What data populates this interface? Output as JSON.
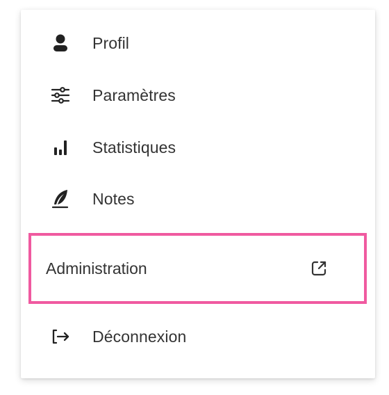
{
  "menu": {
    "items": [
      {
        "label": "Profil",
        "icon": "person-icon"
      },
      {
        "label": "Paramètres",
        "icon": "sliders-icon"
      },
      {
        "label": "Statistiques",
        "icon": "bar-chart-icon"
      },
      {
        "label": "Notes",
        "icon": "feather-icon"
      }
    ],
    "admin": {
      "label": "Administration",
      "icon": "external-link-icon"
    },
    "logout": {
      "label": "Déconnexion",
      "icon": "logout-icon"
    }
  },
  "colors": {
    "highlight_border": "#f05aa0",
    "text": "#333333",
    "icon": "#222222"
  }
}
